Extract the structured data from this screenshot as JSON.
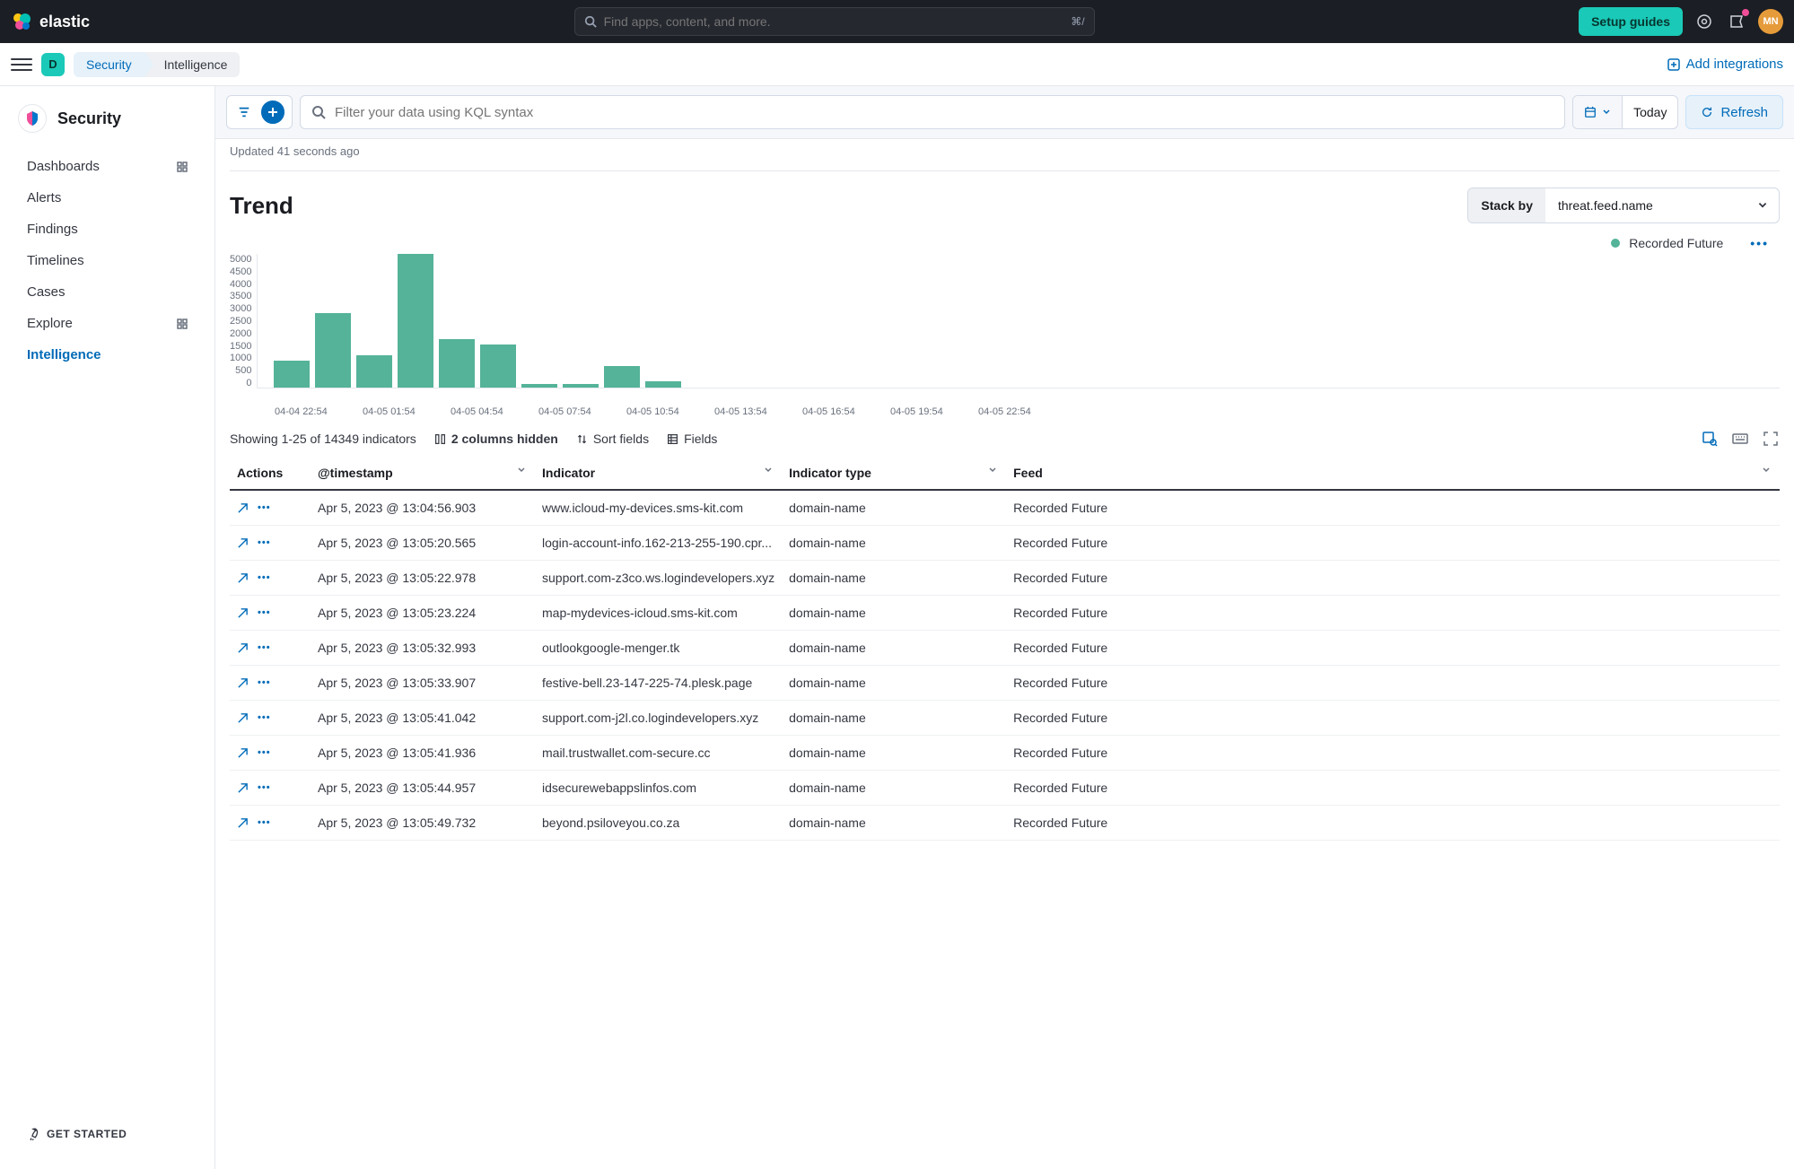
{
  "header": {
    "logo_text": "elastic",
    "search_placeholder": "Find apps, content, and more.",
    "search_shortcut": "⌘/",
    "setup_guides": "Setup guides",
    "avatar_initials": "MN"
  },
  "subheader": {
    "space_letter": "D",
    "crumb1": "Security",
    "crumb2": "Intelligence",
    "add_integrations": "Add integrations"
  },
  "sidebar": {
    "title": "Security",
    "items": [
      {
        "label": "Dashboards",
        "grid": true
      },
      {
        "label": "Alerts"
      },
      {
        "label": "Findings"
      },
      {
        "label": "Timelines"
      },
      {
        "label": "Cases"
      },
      {
        "label": "Explore",
        "grid": true
      },
      {
        "label": "Intelligence",
        "active": true
      }
    ],
    "footer": "GET STARTED"
  },
  "filterbar": {
    "kql_placeholder": "Filter your data using KQL syntax",
    "date_label": "Today",
    "refresh": "Refresh"
  },
  "content": {
    "updated": "Updated 41 seconds ago",
    "trend_title": "Trend",
    "stack_by_label": "Stack by",
    "stack_by_value": "threat.feed.name",
    "legend": "Recorded Future"
  },
  "chart_data": {
    "type": "bar",
    "series_name": "Recorded Future",
    "y_ticks": [
      "5000",
      "4500",
      "4000",
      "3500",
      "3000",
      "2500",
      "2000",
      "1500",
      "1000",
      "500",
      "0"
    ],
    "x_ticks": [
      "04-04 22:54",
      "04-05 01:54",
      "04-05 04:54",
      "04-05 07:54",
      "04-05 10:54",
      "04-05 13:54",
      "04-05 16:54",
      "04-05 19:54",
      "04-05 22:54"
    ],
    "y_max": 5000,
    "values": [
      1000,
      2800,
      1200,
      5200,
      1800,
      1600,
      150,
      120,
      800,
      250,
      0,
      0,
      0,
      0,
      0,
      0,
      0,
      0
    ]
  },
  "table_controls": {
    "showing": "Showing 1-25 of 14349 indicators",
    "hidden_cols": "2 columns hidden",
    "sort_fields": "Sort fields",
    "fields": "Fields"
  },
  "table": {
    "headers": {
      "actions": "Actions",
      "ts": "@timestamp",
      "indicator": "Indicator",
      "type": "Indicator type",
      "feed": "Feed"
    },
    "rows": [
      {
        "ts": "Apr 5, 2023 @ 13:04:56.903",
        "indicator": "www.icloud-my-devices.sms-kit.com",
        "type": "domain-name",
        "feed": "Recorded Future"
      },
      {
        "ts": "Apr 5, 2023 @ 13:05:20.565",
        "indicator": "login-account-info.162-213-255-190.cpr...",
        "type": "domain-name",
        "feed": "Recorded Future"
      },
      {
        "ts": "Apr 5, 2023 @ 13:05:22.978",
        "indicator": "support.com-z3co.ws.logindevelopers.xyz",
        "type": "domain-name",
        "feed": "Recorded Future"
      },
      {
        "ts": "Apr 5, 2023 @ 13:05:23.224",
        "indicator": "map-mydevices-icloud.sms-kit.com",
        "type": "domain-name",
        "feed": "Recorded Future"
      },
      {
        "ts": "Apr 5, 2023 @ 13:05:32.993",
        "indicator": "outlookgoogle-menger.tk",
        "type": "domain-name",
        "feed": "Recorded Future"
      },
      {
        "ts": "Apr 5, 2023 @ 13:05:33.907",
        "indicator": "festive-bell.23-147-225-74.plesk.page",
        "type": "domain-name",
        "feed": "Recorded Future"
      },
      {
        "ts": "Apr 5, 2023 @ 13:05:41.042",
        "indicator": "support.com-j2l.co.logindevelopers.xyz",
        "type": "domain-name",
        "feed": "Recorded Future"
      },
      {
        "ts": "Apr 5, 2023 @ 13:05:41.936",
        "indicator": "mail.trustwallet.com-secure.cc",
        "type": "domain-name",
        "feed": "Recorded Future"
      },
      {
        "ts": "Apr 5, 2023 @ 13:05:44.957",
        "indicator": "idsecurewebappslinfos.com",
        "type": "domain-name",
        "feed": "Recorded Future"
      },
      {
        "ts": "Apr 5, 2023 @ 13:05:49.732",
        "indicator": "beyond.psiloveyou.co.za",
        "type": "domain-name",
        "feed": "Recorded Future"
      }
    ]
  }
}
